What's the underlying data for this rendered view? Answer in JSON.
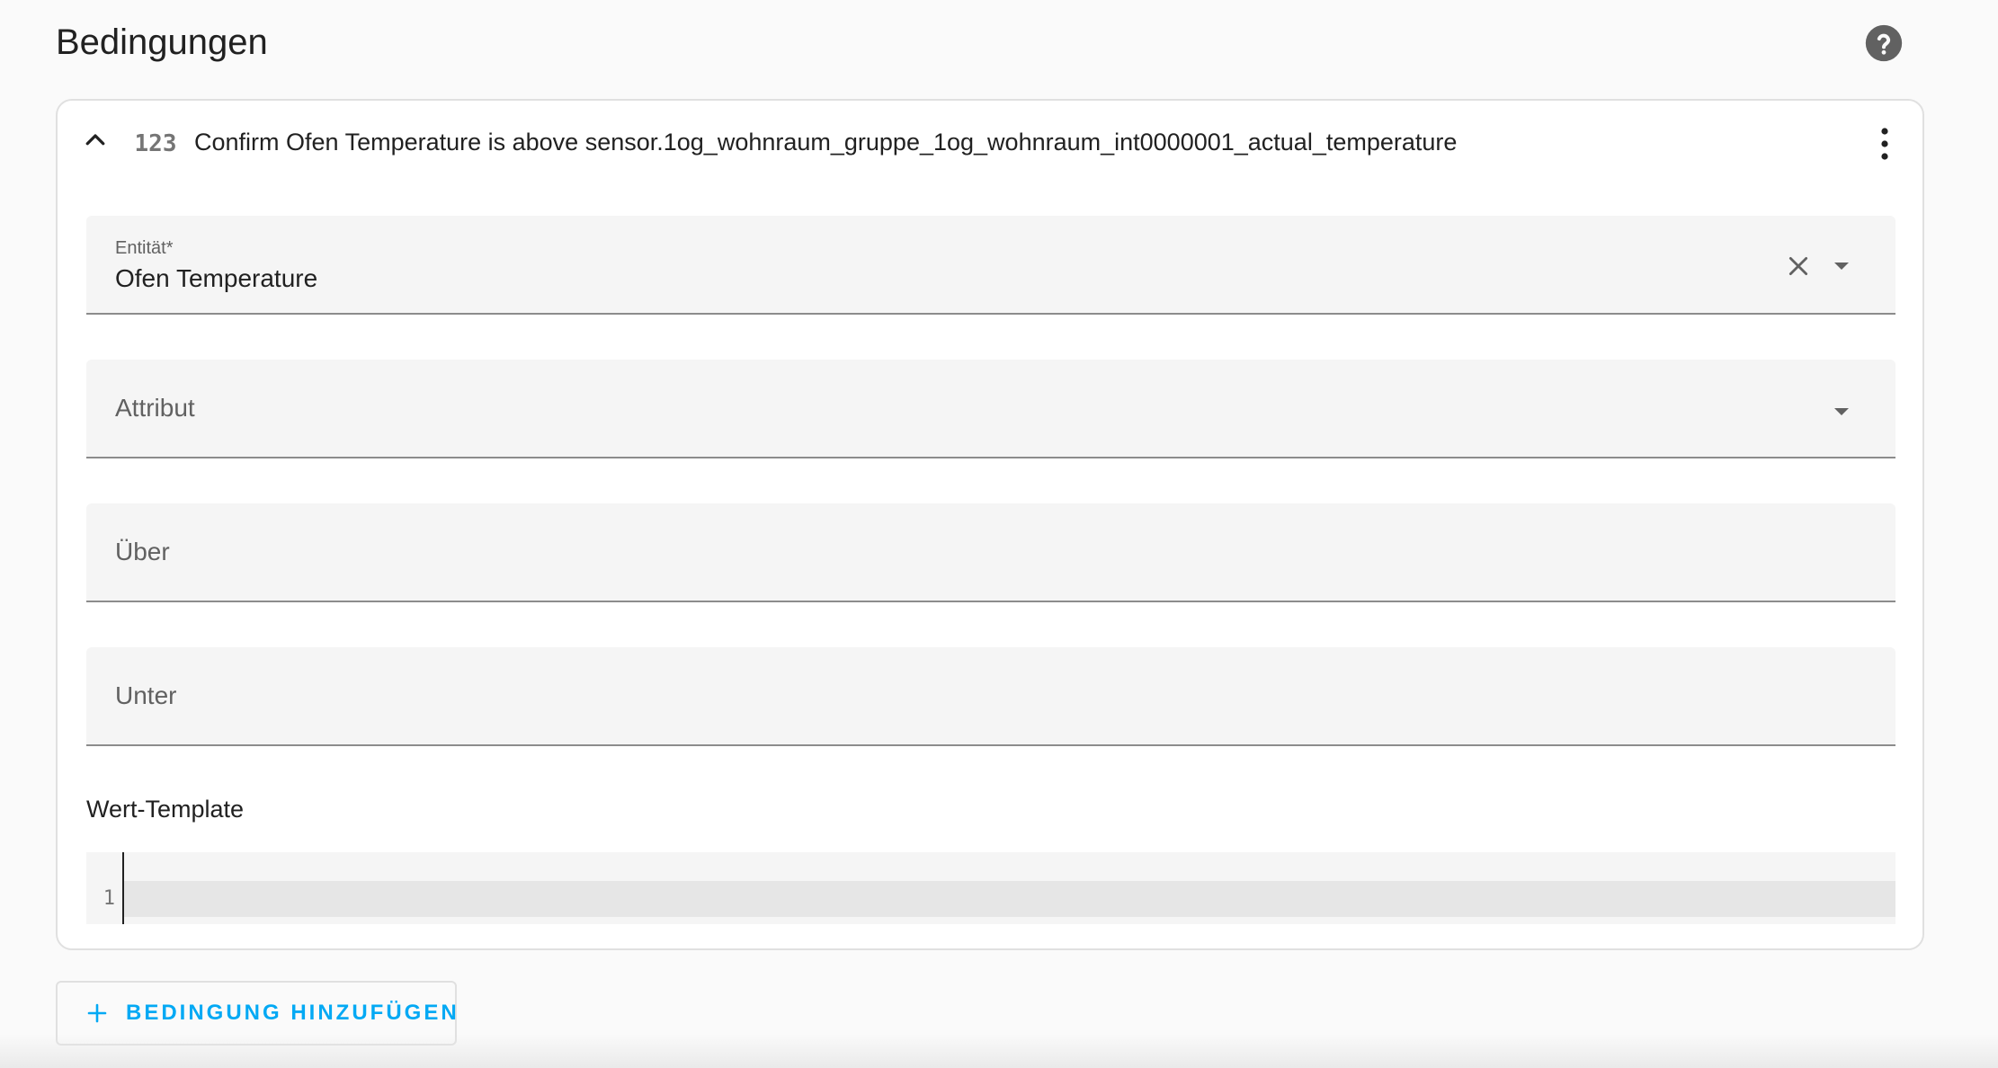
{
  "section": {
    "title": "Bedingungen",
    "help_icon": "help-circle-icon"
  },
  "condition_card": {
    "type_icon_text": "123",
    "title": "Confirm Ofen Temperature is above sensor.1og_wohnraum_gruppe_1og_wohnraum_int0000001_actual_temperature",
    "collapse_icon": "chevron-up-icon",
    "menu_icon": "dots-vertical-icon",
    "fields": {
      "entity": {
        "label": "Entität*",
        "value": "Ofen Temperature"
      },
      "attribute": {
        "placeholder": "Attribut"
      },
      "above": {
        "placeholder": "Über"
      },
      "below": {
        "placeholder": "Unter"
      }
    },
    "value_template": {
      "label": "Wert-Template",
      "line_number": "1",
      "content": ""
    }
  },
  "add_condition_button": {
    "label": "BEDINGUNG HINZUFÜGEN",
    "icon": "plus-icon"
  },
  "colors": {
    "accent": "#03a9f4",
    "field_background": "#f5f5f5",
    "text_primary": "#212121",
    "text_secondary": "#616161",
    "help_icon": "#616161"
  }
}
